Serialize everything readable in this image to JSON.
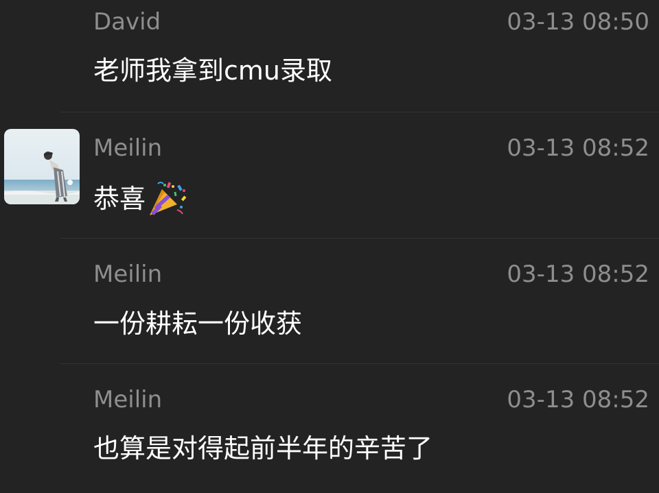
{
  "messages": [
    {
      "sender": "David",
      "time": "03-13 08:50",
      "text": "老师我拿到cmu录取",
      "has_avatar": false
    },
    {
      "sender": "Meilin",
      "time": "03-13 08:52",
      "text": "恭喜",
      "emoji": "party-popper",
      "has_avatar": true
    },
    {
      "sender": "Meilin",
      "time": "03-13 08:52",
      "text": "一份耕耘一份收获",
      "has_avatar": false
    },
    {
      "sender": "Meilin",
      "time": "03-13 08:52",
      "text": "也算是对得起前半年的辛苦了",
      "has_avatar": false
    }
  ],
  "colors": {
    "background": "#232323",
    "meta_text": "#8e8e8e",
    "message_text": "#ffffff",
    "divider": "#333333"
  },
  "icons": {
    "avatar": "beach-photo-avatar",
    "emoji": "party-popper-emoji"
  }
}
